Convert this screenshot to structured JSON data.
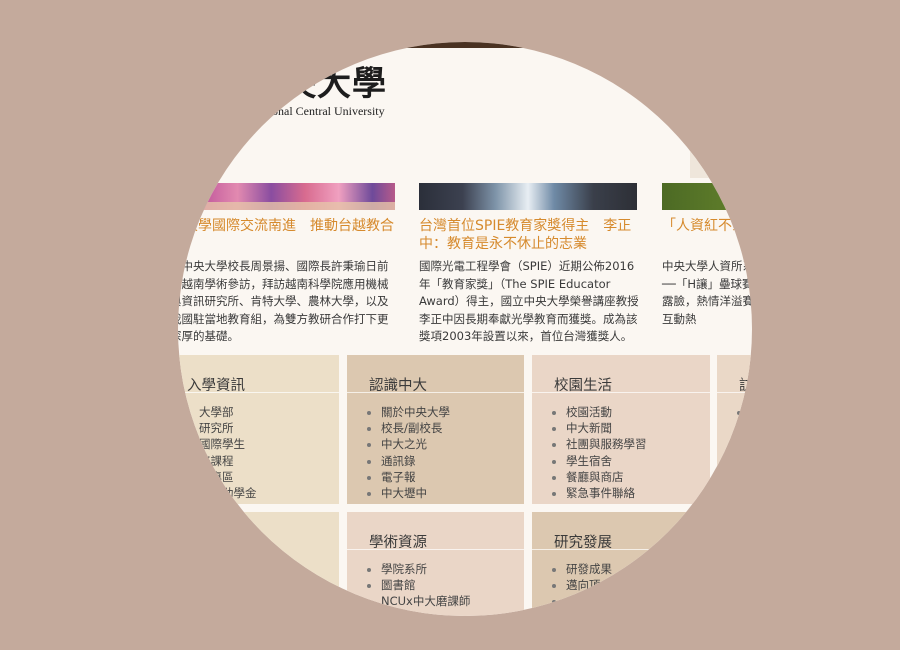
{
  "header": {
    "logo_cn": "央大學",
    "logo_en": "ational Central University"
  },
  "news": [
    {
      "title": "央大學國際交流南進　推動台越教合作",
      "body": "立中央大學校長周景揚、國際長許秉瑜日前赴越南學術參訪，拜訪越南科學院應用機械與資訊研究所、肯特大學、農林大學，以及我國駐當地教育組，為雙方教研合作打下更深厚的基礎。"
    },
    {
      "title": "台灣首位SPIE教育家獎得主　李正中：教育是永不休止的志業",
      "body": "國際光電工程學會（SPIE）近期公佈2016年「教育家獎」（The SPIE Educator Award）得主，國立中央大學榮譽講座教授李正中因長期奉獻光學教育而獲獎。成為該獎項2003年設置以來，首位台灣獲獎人。"
    },
    {
      "title": "「人資紅不家歡",
      "body": "中央大學人資所系列活動──「H讓」壘球賽暨園遊光露臉，熱情洋溢賽況激烈，互動熱"
    }
  ],
  "sections_row1": [
    {
      "title": "入學資訊",
      "items": [
        "大學部",
        "研究所",
        "國際學生",
        "修課程",
        "生專區",
        "及獎助學金"
      ]
    },
    {
      "title": "認識中大",
      "items": [
        "關於中央大學",
        "校長/副校長",
        "中大之光",
        "通訊錄",
        "電子報",
        "中大壢中"
      ]
    },
    {
      "title": "校園生活",
      "items": [
        "校園活動",
        "中大新聞",
        "社團與服務學習",
        "學生宿舍",
        "餐廳與商店",
        "緊急事件聯絡"
      ]
    },
    {
      "title": "訪",
      "items": [
        ""
      ]
    }
  ],
  "sections_row2": [
    {
      "title": "",
      "items": []
    },
    {
      "title": "學術資源",
      "items": [
        "學院系所",
        "圖書館",
        "NCUx中大磨課師",
        "…"
      ]
    },
    {
      "title": "研究發展",
      "items": [
        "研發成果",
        "邁向頂尖",
        "…"
      ]
    }
  ]
}
